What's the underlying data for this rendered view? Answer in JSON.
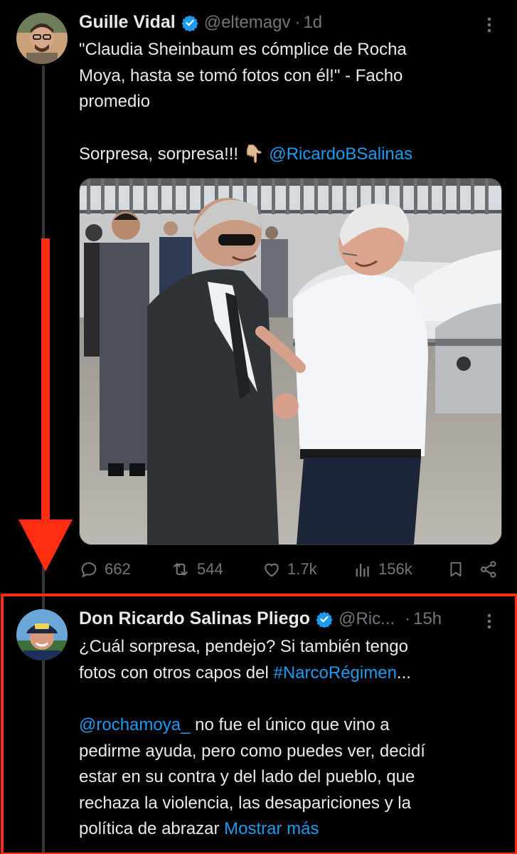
{
  "tweet1": {
    "name": "Guille Vidal",
    "handle": "@eltemagv",
    "dot": "·",
    "time": "1d",
    "text_line1": "\"Claudia Sheinbaum es cómplice de Rocha",
    "text_line2": "Moya, hasta se tomó fotos con él!\" - Facho",
    "text_line3": "promedio",
    "text_line4_prefix": "Sorpresa, sorpresa!!! ",
    "emoji": "👇🏼",
    "mention": "@RicardoBSalinas",
    "stats": {
      "replies": "662",
      "retweets": "544",
      "likes": "1.7k",
      "views": "156k"
    }
  },
  "tweet2": {
    "name": "Don Ricardo Salinas Pliego",
    "handle": "@Ric...",
    "dot": "·",
    "time": "15h",
    "line1": "¿Cuál sorpresa, pendejo? Si también tengo",
    "line2_prefix": "fotos con otros capos del ",
    "hashtag": "#NarcoRégimen",
    "ellipsis": "...",
    "mention": "@rochamoya_",
    "line3_suffix": " no fue el único que vino a",
    "line4": "pedirme ayuda, pero como puedes ver, decidí",
    "line5": "estar en su contra y del lado del pueblo, que",
    "line6": "rechaza la violencia, las desapariciones y la",
    "line7_prefix": "política de abrazar ",
    "show_more": "Mostrar más"
  },
  "colors": {
    "background": "#000000",
    "text": "#e7e9ea",
    "muted": "#71767b",
    "link": "#1d9bf0",
    "annotation_red": "#ff2e12"
  },
  "icons": [
    "verified-badge-icon",
    "more-options-icon",
    "reply-icon",
    "retweet-icon",
    "like-icon",
    "views-icon",
    "bookmark-icon",
    "share-icon"
  ]
}
